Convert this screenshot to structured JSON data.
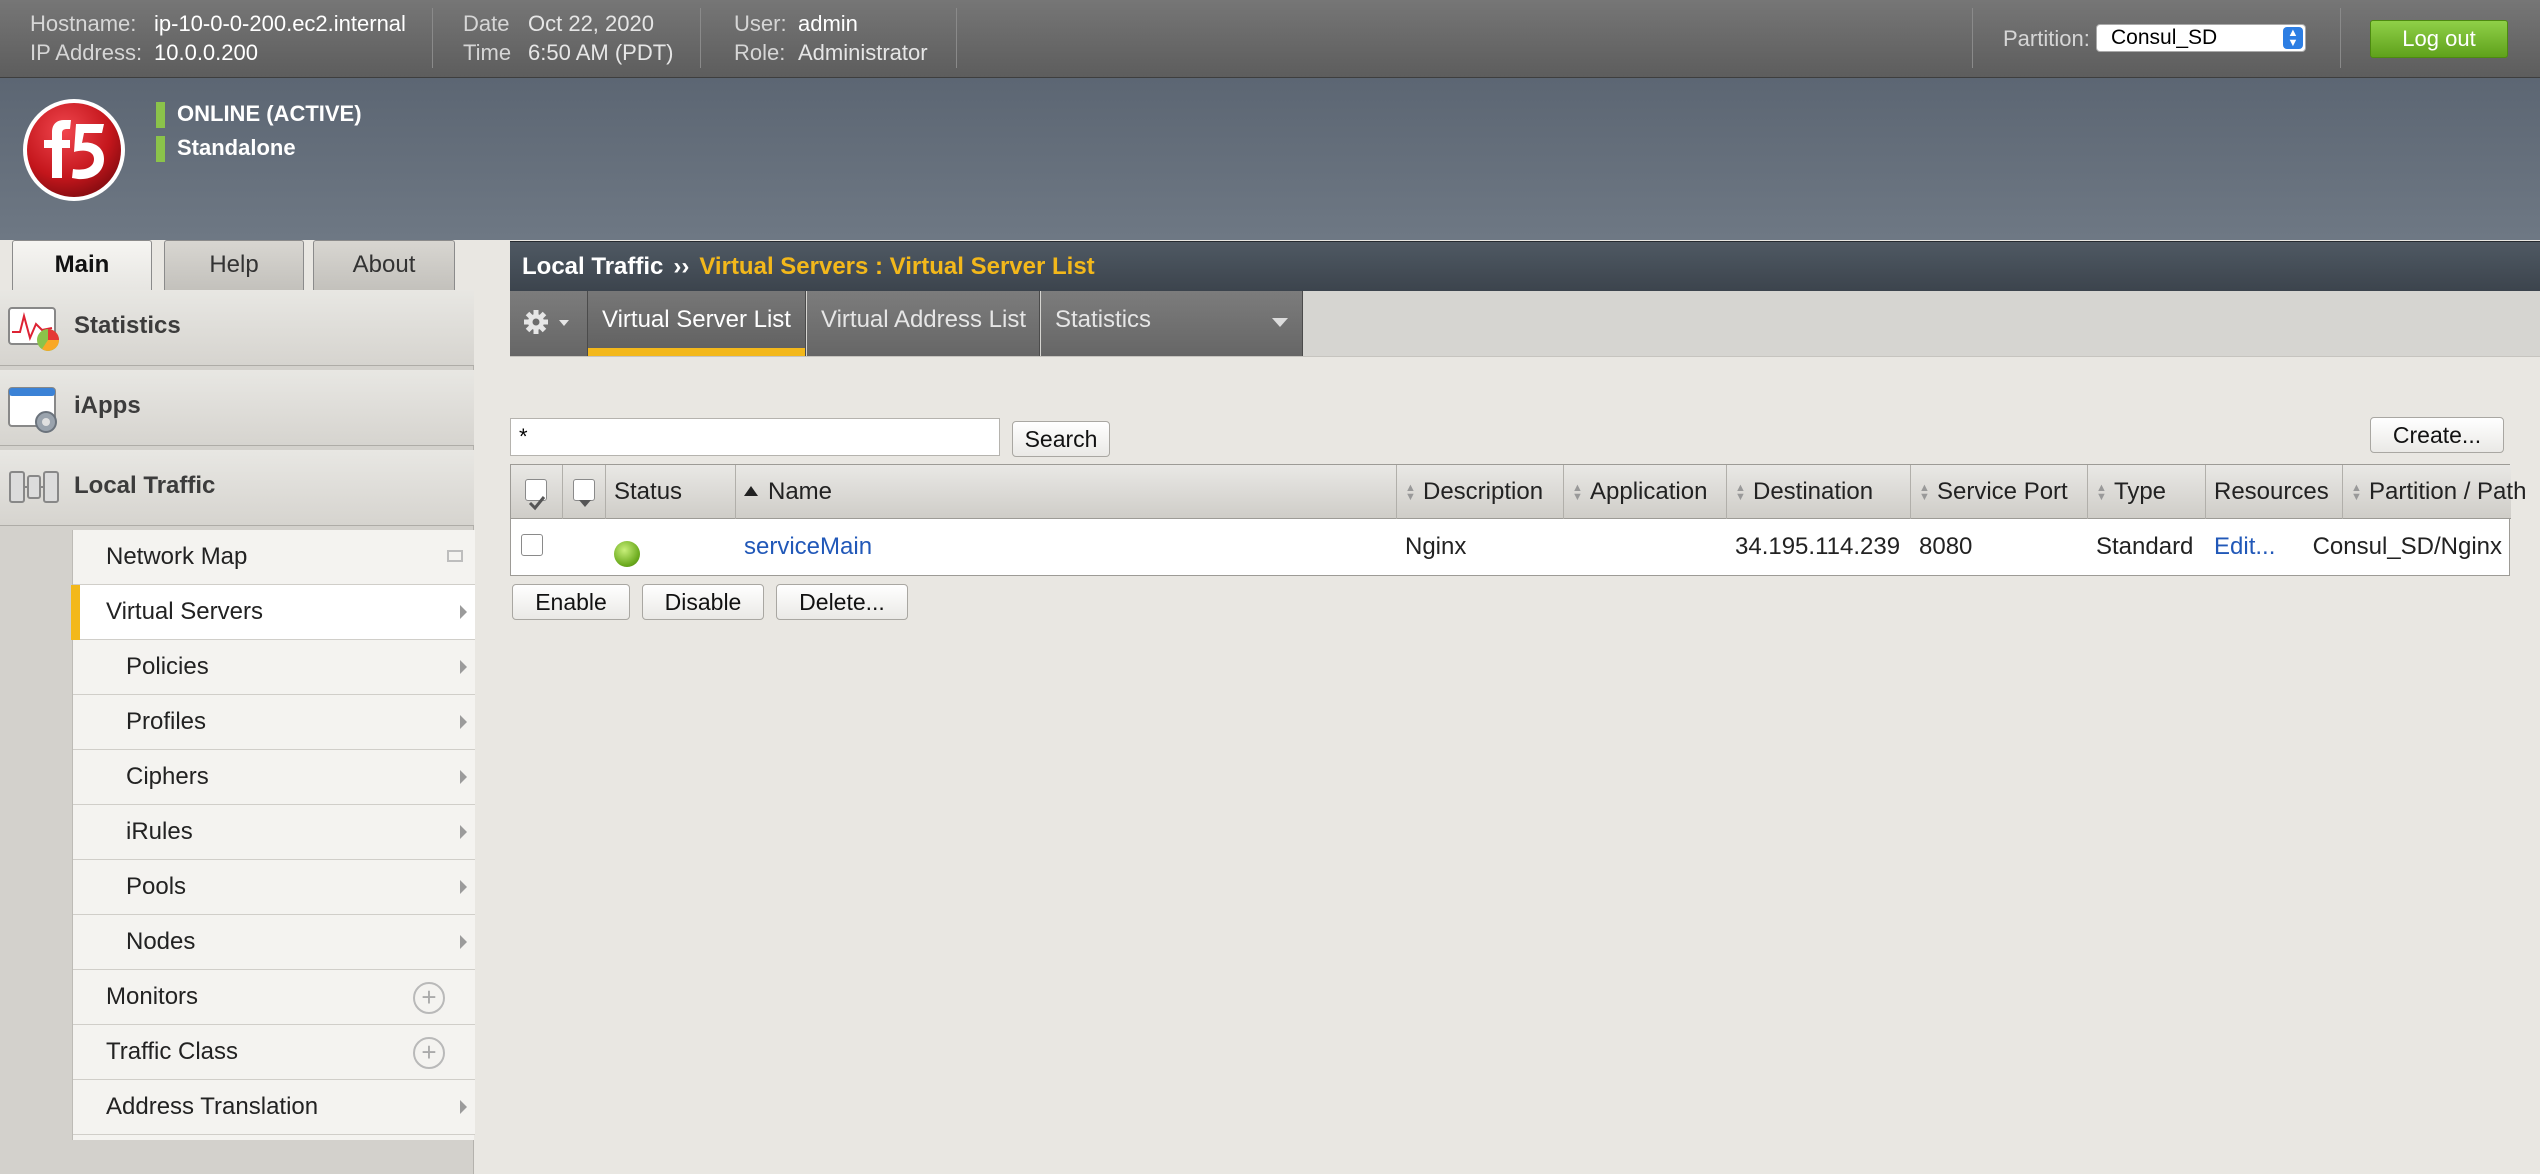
{
  "topbar": {
    "hostname_label": "Hostname:",
    "hostname": "ip-10-0-0-200.ec2.internal",
    "ip_label": "IP Address:",
    "ip": "10.0.0.200",
    "date_label": "Date",
    "date": "Oct 22, 2020",
    "time_label": "Time",
    "time": "6:50 AM (PDT)",
    "user_label": "User:",
    "user": "admin",
    "role_label": "Role:",
    "role": "Administrator",
    "partition_label": "Partition:",
    "partition_value": "Consul_SD",
    "logout_label": "Log out"
  },
  "brand": {
    "status_online": "ONLINE (ACTIVE)",
    "status_mode": "Standalone",
    "status_color": "#8bc34a"
  },
  "main_tabs": [
    {
      "label": "Main",
      "active": true
    },
    {
      "label": "Help",
      "active": false
    },
    {
      "label": "About",
      "active": false
    }
  ],
  "nav": {
    "sections": [
      {
        "label": "Statistics",
        "icon": "statistics-icon"
      },
      {
        "label": "iApps",
        "icon": "iapps-icon"
      },
      {
        "label": "Local Traffic",
        "icon": "local-traffic-icon"
      }
    ],
    "sub_items": [
      {
        "label": "Network Map",
        "indent": false,
        "control": "map"
      },
      {
        "label": "Virtual Servers",
        "indent": false,
        "control": "arrow",
        "selected": true
      },
      {
        "label": "Policies",
        "indent": true,
        "control": "arrow"
      },
      {
        "label": "Profiles",
        "indent": true,
        "control": "arrow"
      },
      {
        "label": "Ciphers",
        "indent": true,
        "control": "arrow"
      },
      {
        "label": "iRules",
        "indent": true,
        "control": "arrow"
      },
      {
        "label": "Pools",
        "indent": true,
        "control": "arrow"
      },
      {
        "label": "Nodes",
        "indent": true,
        "control": "arrow"
      },
      {
        "label": "Monitors",
        "indent": false,
        "control": "plus"
      },
      {
        "label": "Traffic Class",
        "indent": false,
        "control": "plus"
      },
      {
        "label": "Address Translation",
        "indent": false,
        "control": "arrow"
      }
    ]
  },
  "breadcrumb": {
    "section": "Local Traffic",
    "separator": "››",
    "current": "Virtual Servers : Virtual Server List"
  },
  "sub_tabs": [
    {
      "label": "Virtual Server List",
      "active": true
    },
    {
      "label": "Virtual Address List",
      "active": false
    },
    {
      "label": "Statistics",
      "active": false,
      "dropdown": true
    }
  ],
  "search": {
    "value": "*",
    "button_label": "Search"
  },
  "create_label": "Create...",
  "table": {
    "columns": [
      "Status",
      "Name",
      "Description",
      "Application",
      "Destination",
      "Service Port",
      "Type",
      "Resources",
      "Partition / Path"
    ],
    "rows": [
      {
        "name": "serviceMain",
        "description": "Nginx",
        "application": "",
        "destination": "34.195.114.239",
        "service_port": "8080",
        "type": "Standard",
        "resources": "Edit...",
        "partition_path": "Consul_SD/Nginx",
        "status_color": "#6cab1e"
      }
    ]
  },
  "actions": {
    "enable": "Enable",
    "disable": "Disable",
    "delete": "Delete..."
  },
  "colors": {
    "accent_yellow": "#f3b81b",
    "logout_green": "#6fb226",
    "link_blue": "#2158b8"
  }
}
